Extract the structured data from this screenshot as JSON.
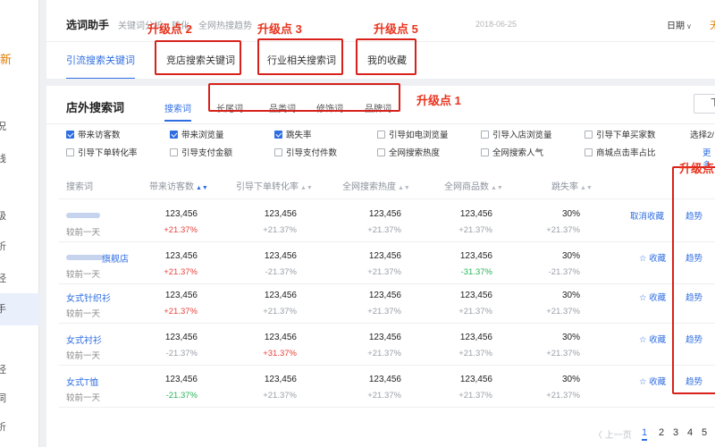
{
  "sidebar": {
    "logo_text": "新",
    "items": [
      {
        "label": "况"
      },
      {
        "label": "线"
      },
      {
        "label": "级"
      },
      {
        "label": "析"
      },
      {
        "label": "经"
      },
      {
        "label": "手"
      },
      {
        "label": "经"
      },
      {
        "label": "词"
      },
      {
        "label": "析"
      }
    ]
  },
  "topbar": {
    "title": "选词助手",
    "description": "关键词分析、转化、全网热搜趋势",
    "date_range": "2018-06-25",
    "date_unit": "日期",
    "date_chevron": "chevron-down-icon",
    "right_cut": "无"
  },
  "tabs": [
    {
      "label": "引流搜索关键词",
      "active": true
    },
    {
      "label": "竞店搜索关键词",
      "active": false
    },
    {
      "label": "行业相关搜索词",
      "active": false
    },
    {
      "label": "我的收藏",
      "active": false
    }
  ],
  "panel": {
    "title": "店外搜索词",
    "subtabs": [
      {
        "label": "搜索词",
        "active": true
      },
      {
        "label": "长尾词"
      },
      {
        "label": "品类词"
      },
      {
        "label": "修饰词"
      },
      {
        "label": "品牌词"
      }
    ],
    "right_button": "下",
    "metrics_row1": [
      {
        "label": "带来访客数",
        "checked": true
      },
      {
        "label": "带来浏览量",
        "checked": true
      },
      {
        "label": "跳失率",
        "checked": true
      },
      {
        "label": "引导如电浏览量",
        "checked": false
      },
      {
        "label": "引导入店浏览量",
        "checked": false
      },
      {
        "label": "引导下单买家数",
        "checked": false
      }
    ],
    "metrics_row2": [
      {
        "label": "引导下单转化率",
        "checked": false
      },
      {
        "label": "引导支付金额",
        "checked": false
      },
      {
        "label": "引导支付件数",
        "checked": false
      },
      {
        "label": "全网搜索热度",
        "checked": false
      },
      {
        "label": "全网搜索人气",
        "checked": false
      },
      {
        "label": "商城点击率占比",
        "checked": false
      }
    ],
    "selected_info": "选择2/",
    "more_link": "更多"
  },
  "table": {
    "headers": [
      "搜索词",
      "带来访客数",
      "引导下单转化率",
      "全网搜索热度",
      "全网商品数",
      "跳失率"
    ],
    "sort_icon": "sort-icon",
    "compare_label": "较前一天",
    "trend_label": "趋势",
    "rows": [
      {
        "keyword": "",
        "blurred": true,
        "values": [
          "123,456",
          "123,456",
          "123,456",
          "123,456",
          "30%"
        ],
        "changes": [
          "+21.37%",
          "+21.37%",
          "+21.37%",
          "+21.37%",
          "+21.37%"
        ],
        "change_colors": [
          "red",
          "gray",
          "gray",
          "gray",
          "gray"
        ],
        "action": "取消收藏"
      },
      {
        "keyword": "旗舰店",
        "blurred": true,
        "values": [
          "123,456",
          "123,456",
          "123,456",
          "123,456",
          "30%"
        ],
        "changes": [
          "+21.37%",
          "-21.37%",
          "+21.37%",
          "-31.37%",
          "-21.37%"
        ],
        "change_colors": [
          "red",
          "gray",
          "gray",
          "green",
          "gray"
        ],
        "action": "☆ 收藏"
      },
      {
        "keyword": "女式针织衫",
        "blurred": false,
        "values": [
          "123,456",
          "123,456",
          "123,456",
          "123,456",
          "30%"
        ],
        "changes": [
          "+21.37%",
          "+21.37%",
          "+21.37%",
          "+21.37%",
          "+21.37%"
        ],
        "change_colors": [
          "red",
          "gray",
          "gray",
          "gray",
          "gray"
        ],
        "action": "☆ 收藏"
      },
      {
        "keyword": "女式衬衫",
        "blurred": false,
        "values": [
          "123,456",
          "123,456",
          "123,456",
          "123,456",
          "30%"
        ],
        "changes": [
          "-21.37%",
          "+31.37%",
          "+21.37%",
          "+21.37%",
          "+21.37%"
        ],
        "change_colors": [
          "gray",
          "red",
          "gray",
          "gray",
          "gray"
        ],
        "action": "☆ 收藏"
      },
      {
        "keyword": "女式T恤",
        "blurred": false,
        "values": [
          "123,456",
          "123,456",
          "123,456",
          "123,456",
          "30%"
        ],
        "changes": [
          "-21.37%",
          "+21.37%",
          "+21.37%",
          "+21.37%",
          "+21.37%"
        ],
        "change_colors": [
          "green",
          "gray",
          "gray",
          "gray",
          "gray"
        ],
        "action": "☆ 收藏"
      }
    ]
  },
  "pagination": {
    "prev": "〈 上一页",
    "pages": [
      "1",
      "2",
      "3",
      "4",
      "5"
    ],
    "current": "1"
  },
  "annotations": {
    "label_2": "升级点 2",
    "label_3": "升级点 3",
    "label_5": "升级点 5",
    "label_1": "升级点 1",
    "label_4": "升级点",
    "color": "#d7211a"
  },
  "colors": {
    "accent": "#2f6ee2",
    "up_red": "#e8423c",
    "down_green": "#28b45a"
  }
}
